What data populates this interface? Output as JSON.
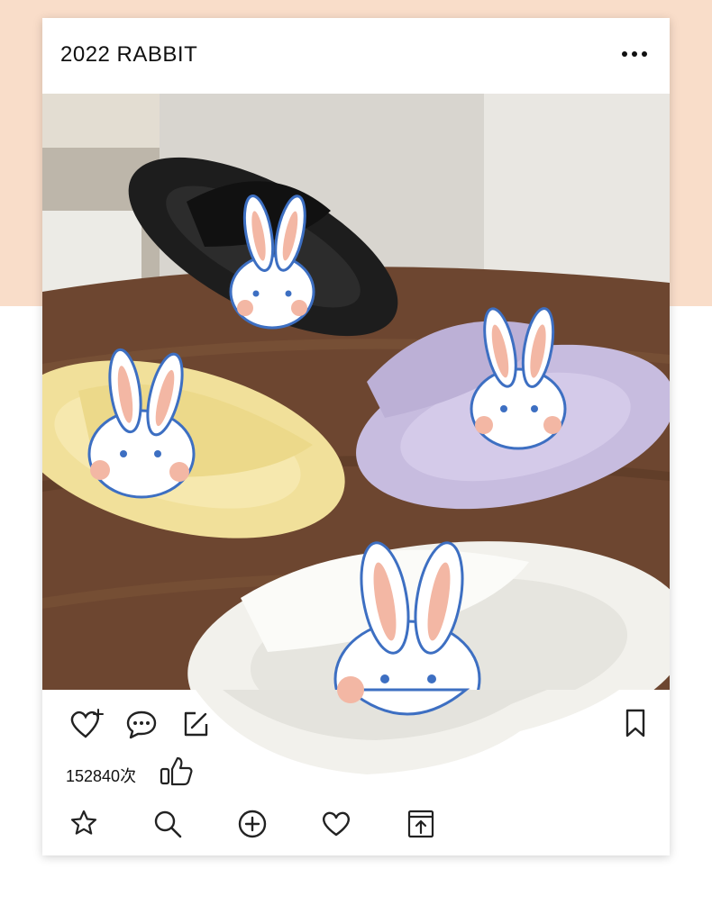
{
  "post": {
    "title": "2022 RABBIT",
    "like_count": "152840次"
  },
  "colors": {
    "background_peach": "#f9ddc9",
    "card": "#ffffff",
    "icon_stroke": "#222222"
  },
  "icons": {
    "top_right": "more-dots-icon",
    "action_row": [
      "heart-plus-icon",
      "comment-icon",
      "edit-icon",
      "bookmark-icon"
    ],
    "like_indicator": "thumbs-up-icon",
    "bottom_nav": [
      "star-icon",
      "search-icon",
      "add-icon",
      "heart-icon",
      "share-upload-icon"
    ]
  },
  "photo": {
    "subject": "four rabbit slippers (black, lavender, yellow, white) on a wooden table"
  }
}
